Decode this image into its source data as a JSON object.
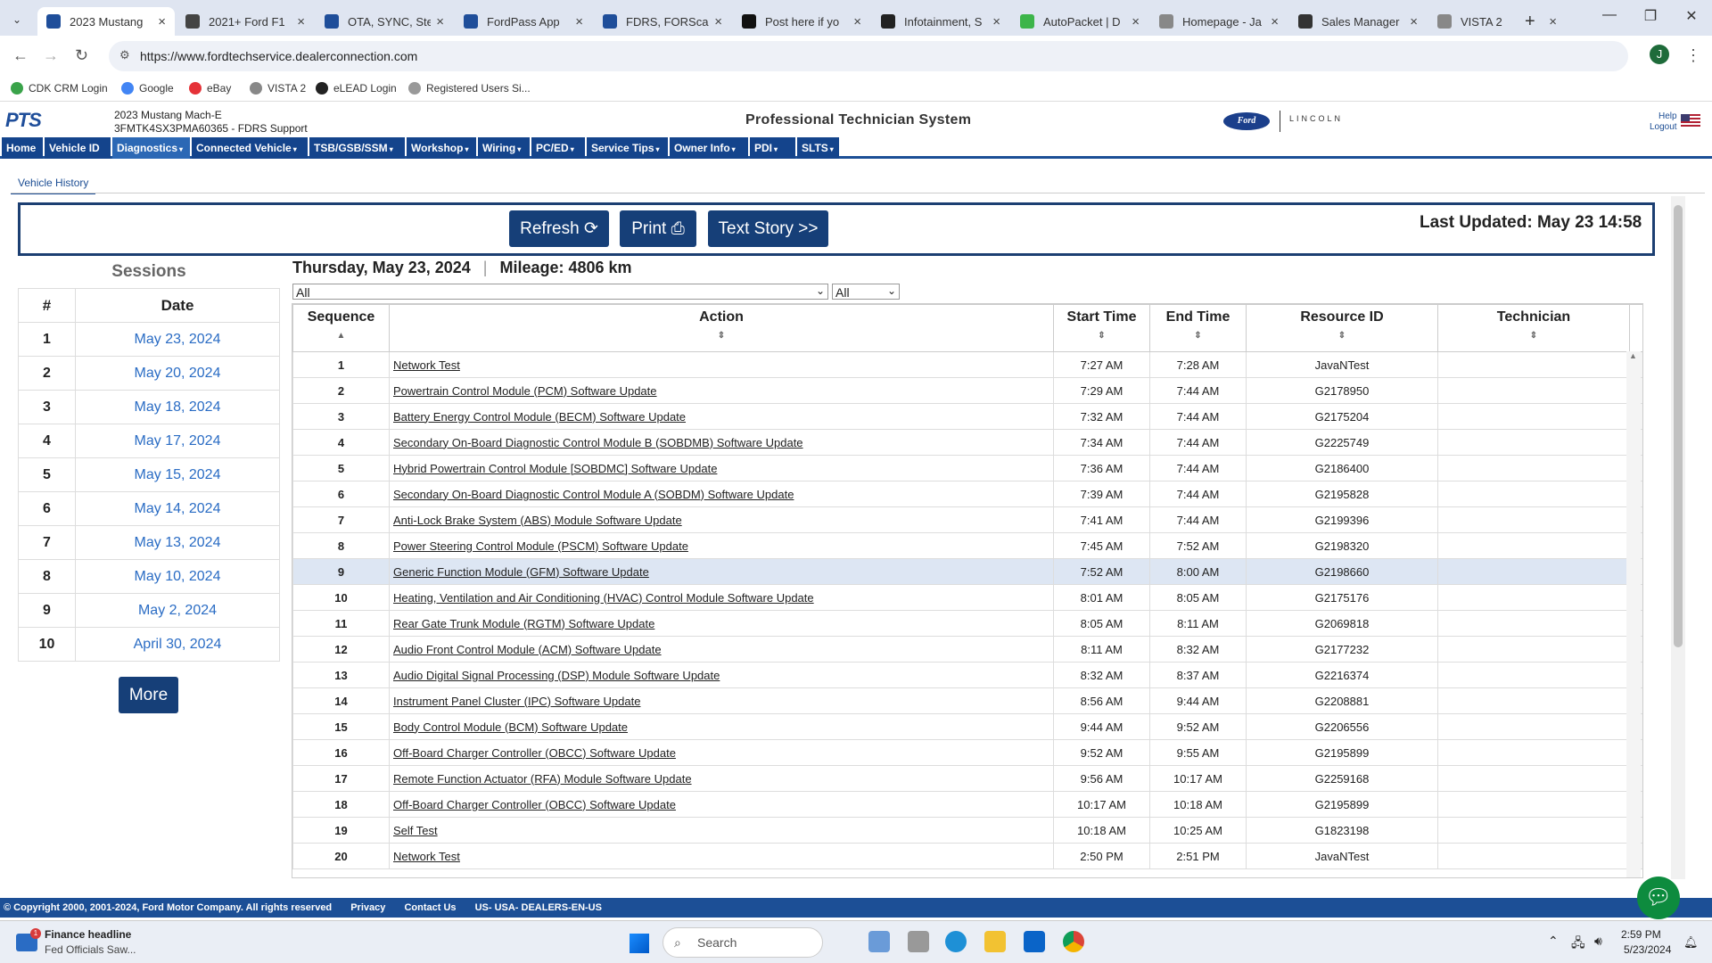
{
  "browser": {
    "tabs": [
      {
        "title": "2023 Mustang",
        "icon": "pts-favicon",
        "color": "#1f4e9a",
        "active": true
      },
      {
        "title": "2021+ Ford F1",
        "icon": "forum-favicon",
        "color": "#444"
      },
      {
        "title": "OTA, SYNC, Ste",
        "icon": "pts-favicon",
        "color": "#1f4e9a"
      },
      {
        "title": "FordPass App",
        "icon": "f-favicon",
        "color": "#1f4e9a"
      },
      {
        "title": "FDRS, FORScan",
        "icon": "f-favicon",
        "color": "#1f4e9a"
      },
      {
        "title": "Post here if yo",
        "icon": "forum-favicon",
        "color": "#111"
      },
      {
        "title": "Infotainment, S",
        "icon": "mach-favicon",
        "color": "#222"
      },
      {
        "title": "AutoPacket | D",
        "icon": "autopacket-favicon",
        "color": "#3db54a"
      },
      {
        "title": "Homepage - Ja",
        "icon": "r-favicon",
        "color": "#888"
      },
      {
        "title": "Sales Manager",
        "icon": "grid-favicon",
        "color": "#333"
      },
      {
        "title": "VISTA 2",
        "icon": "vista-favicon",
        "color": "#888"
      }
    ],
    "url": "https://www.fordtechservice.dealerconnection.com",
    "profile_initial": "J",
    "bookmarks": [
      {
        "label": "CDK CRM Login",
        "color": "#3aa34a"
      },
      {
        "label": "Google",
        "color": "#4285f4"
      },
      {
        "label": "eBay",
        "color": "#e53238"
      },
      {
        "label": "VISTA 2",
        "color": "#888"
      },
      {
        "label": "eLEAD Login",
        "color": "#222"
      },
      {
        "label": "Registered Users Si...",
        "color": "#999"
      }
    ]
  },
  "pts": {
    "logo": "PTS",
    "vehicle_line1": "2023 Mustang Mach-E",
    "vehicle_line2": "3FMTK4SX3PMA60365 - FDRS Support",
    "title": "Professional Technician System",
    "ford_logo": "Ford",
    "lincoln_logo": "LINCOLN",
    "help": "Help",
    "logout": "Logout",
    "nav": [
      "Home",
      "Vehicle ID",
      "Diagnostics",
      "Connected Vehicle",
      "TSB/GSB/SSM",
      "Workshop",
      "Wiring",
      "PC/ED",
      "Service Tips",
      "Owner Info",
      "PDI",
      "SLTS"
    ],
    "active_nav": "Diagnostics"
  },
  "page": {
    "tab_label": "Vehicle History",
    "refresh": "Refresh",
    "print": "Print",
    "text_story": "Text Story >>",
    "last_updated": "Last Updated: May 23 14:58",
    "sessions_title": "Sessions",
    "sessions_headers": [
      "#",
      "Date"
    ],
    "sessions": [
      {
        "n": "1",
        "date": "May 23, 2024"
      },
      {
        "n": "2",
        "date": "May 20, 2024"
      },
      {
        "n": "3",
        "date": "May 18, 2024"
      },
      {
        "n": "4",
        "date": "May 17, 2024"
      },
      {
        "n": "5",
        "date": "May 15, 2024"
      },
      {
        "n": "6",
        "date": "May 14, 2024"
      },
      {
        "n": "7",
        "date": "May 13, 2024"
      },
      {
        "n": "8",
        "date": "May 10, 2024"
      },
      {
        "n": "9",
        "date": "May 2, 2024"
      },
      {
        "n": "10",
        "date": "April 30, 2024"
      }
    ],
    "more": "More",
    "day_title": "Thursday, May 23, 2024",
    "mileage": "Mileage: 4806 km",
    "filter1": "All",
    "filter2": "All",
    "columns": [
      "Sequence",
      "Action",
      "Start Time",
      "End Time",
      "Resource ID",
      "Technician"
    ],
    "rows": [
      {
        "seq": "1",
        "action": "Network Test",
        "start": "7:27 AM",
        "end": "7:28 AM",
        "res": "JavaNTest",
        "tech": ""
      },
      {
        "seq": "2",
        "action": "Powertrain Control Module (PCM) Software Update",
        "start": "7:29 AM",
        "end": "7:44 AM",
        "res": "G2178950",
        "tech": ""
      },
      {
        "seq": "3",
        "action": "Battery Energy Control Module (BECM) Software Update",
        "start": "7:32 AM",
        "end": "7:44 AM",
        "res": "G2175204",
        "tech": ""
      },
      {
        "seq": "4",
        "action": "Secondary On-Board Diagnostic Control Module B (SOBDMB) Software Update",
        "start": "7:34 AM",
        "end": "7:44 AM",
        "res": "G2225749",
        "tech": ""
      },
      {
        "seq": "5",
        "action": "Hybrid Powertrain Control Module [SOBDMC] Software Update",
        "start": "7:36 AM",
        "end": "7:44 AM",
        "res": "G2186400",
        "tech": ""
      },
      {
        "seq": "6",
        "action": "Secondary On-Board Diagnostic Control Module A (SOBDM) Software Update",
        "start": "7:39 AM",
        "end": "7:44 AM",
        "res": "G2195828",
        "tech": ""
      },
      {
        "seq": "7",
        "action": "Anti-Lock Brake System (ABS) Module Software Update",
        "start": "7:41 AM",
        "end": "7:44 AM",
        "res": "G2199396",
        "tech": ""
      },
      {
        "seq": "8",
        "action": "Power Steering Control Module (PSCM) Software Update",
        "start": "7:45 AM",
        "end": "7:52 AM",
        "res": "G2198320",
        "tech": ""
      },
      {
        "seq": "9",
        "action": "Generic Function Module (GFM) Software Update",
        "start": "7:52 AM",
        "end": "8:00 AM",
        "res": "G2198660",
        "tech": "",
        "highlight": true
      },
      {
        "seq": "10",
        "action": "Heating, Ventilation and Air Conditioning (HVAC) Control Module Software Update",
        "start": "8:01 AM",
        "end": "8:05 AM",
        "res": "G2175176",
        "tech": ""
      },
      {
        "seq": "11",
        "action": "Rear Gate Trunk Module (RGTM) Software Update",
        "start": "8:05 AM",
        "end": "8:11 AM",
        "res": "G2069818",
        "tech": ""
      },
      {
        "seq": "12",
        "action": "Audio Front Control Module (ACM) Software Update",
        "start": "8:11 AM",
        "end": "8:32 AM",
        "res": "G2177232",
        "tech": ""
      },
      {
        "seq": "13",
        "action": "Audio Digital Signal Processing (DSP) Module Software Update",
        "start": "8:32 AM",
        "end": "8:37 AM",
        "res": "G2216374",
        "tech": ""
      },
      {
        "seq": "14",
        "action": "Instrument Panel Cluster (IPC) Software Update",
        "start": "8:56 AM",
        "end": "9:44 AM",
        "res": "G2208881",
        "tech": ""
      },
      {
        "seq": "15",
        "action": "Body Control Module (BCM) Software Update",
        "start": "9:44 AM",
        "end": "9:52 AM",
        "res": "G2206556",
        "tech": ""
      },
      {
        "seq": "16",
        "action": "Off-Board Charger Controller (OBCC) Software Update",
        "start": "9:52 AM",
        "end": "9:55 AM",
        "res": "G2195899",
        "tech": ""
      },
      {
        "seq": "17",
        "action": "Remote Function Actuator (RFA) Module Software Update",
        "start": "9:56 AM",
        "end": "10:17 AM",
        "res": "G2259168",
        "tech": ""
      },
      {
        "seq": "18",
        "action": "Off-Board Charger Controller (OBCC) Software Update",
        "start": "10:17 AM",
        "end": "10:18 AM",
        "res": "G2195899",
        "tech": ""
      },
      {
        "seq": "19",
        "action": "Self Test",
        "start": "10:18 AM",
        "end": "10:25 AM",
        "res": "G1823198",
        "tech": ""
      },
      {
        "seq": "20",
        "action": "Network Test",
        "start": "2:50 PM",
        "end": "2:51 PM",
        "res": "JavaNTest",
        "tech": ""
      }
    ]
  },
  "footer": {
    "copyright": "© Copyright 2000, 2001-2024, Ford Motor Company. All rights reserved",
    "privacy": "Privacy",
    "contact": "Contact Us",
    "locale": "US- USA- DEALERS-EN-US"
  },
  "taskbar": {
    "news_title": "Finance headline",
    "news_sub": "Fed Officials Saw...",
    "search": "Search",
    "time": "2:59 PM",
    "date": "5/23/2024"
  }
}
